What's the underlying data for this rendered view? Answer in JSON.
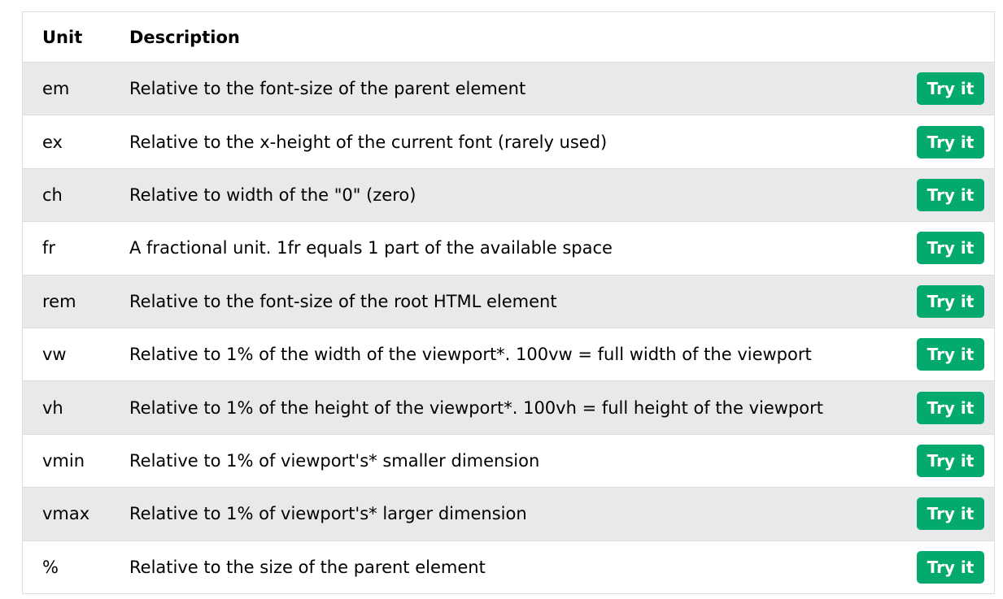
{
  "table": {
    "headers": {
      "unit": "Unit",
      "description": "Description"
    },
    "button_label": "Try it",
    "rows": [
      {
        "unit": "em",
        "description": "Relative to the font-size of the parent element"
      },
      {
        "unit": "ex",
        "description": "Relative to the x-height of the current font (rarely used)"
      },
      {
        "unit": "ch",
        "description": "Relative to width of the \"0\" (zero)"
      },
      {
        "unit": "fr",
        "description": "A fractional unit. 1fr equals 1 part of the available space"
      },
      {
        "unit": "rem",
        "description": "Relative to the font-size of the root HTML element"
      },
      {
        "unit": "vw",
        "description": "Relative to 1% of the width of the viewport*. 100vw = full width of the viewport"
      },
      {
        "unit": "vh",
        "description": "Relative to 1% of the height of the viewport*. 100vh = full height of the viewport"
      },
      {
        "unit": "vmin",
        "description": "Relative to 1% of viewport's* smaller dimension"
      },
      {
        "unit": "vmax",
        "description": "Relative to 1% of viewport's* larger dimension"
      },
      {
        "unit": "%",
        "description": "Relative to the size of the parent element"
      }
    ]
  },
  "colors": {
    "button": "#04aa6d",
    "shaded_row": "#e7e9eb",
    "border": "#dddddd"
  }
}
